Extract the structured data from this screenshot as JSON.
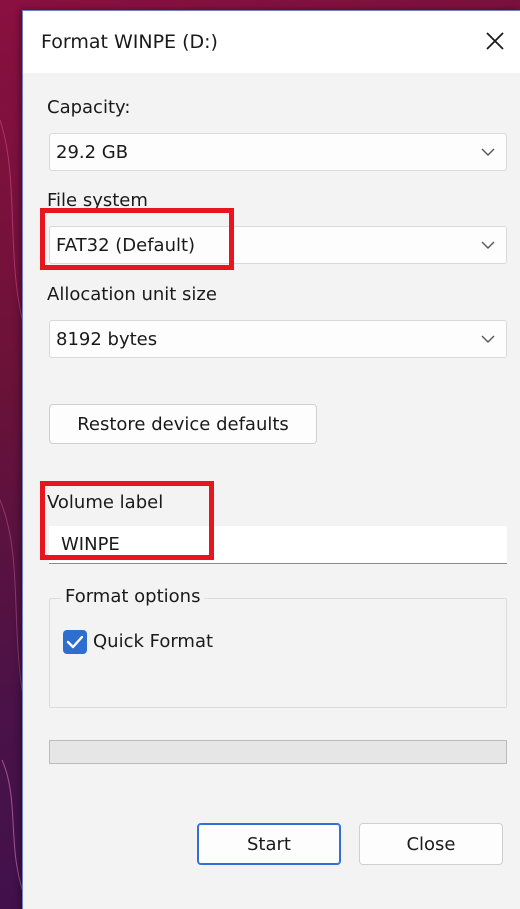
{
  "dialog": {
    "title": "Format WINPE (D:)"
  },
  "capacity": {
    "label": "Capacity:",
    "value": "29.2 GB"
  },
  "file_system": {
    "label": "File system",
    "value": "FAT32 (Default)"
  },
  "allocation": {
    "label": "Allocation unit size",
    "value": "8192 bytes"
  },
  "restore_button": {
    "label": "Restore device defaults"
  },
  "volume": {
    "label": "Volume label",
    "value": "WINPE"
  },
  "format_options": {
    "legend": "Format options",
    "quick_format": {
      "label": "Quick Format",
      "checked": true
    }
  },
  "progress": {
    "value": 0
  },
  "buttons": {
    "start": "Start",
    "close": "Close"
  },
  "colors": {
    "accent": "#2d6ecf",
    "highlight": "#e8141e"
  },
  "icons": {
    "close": "close-icon",
    "dropdown": "chevron-down-icon",
    "checkmark": "checkmark-icon"
  }
}
